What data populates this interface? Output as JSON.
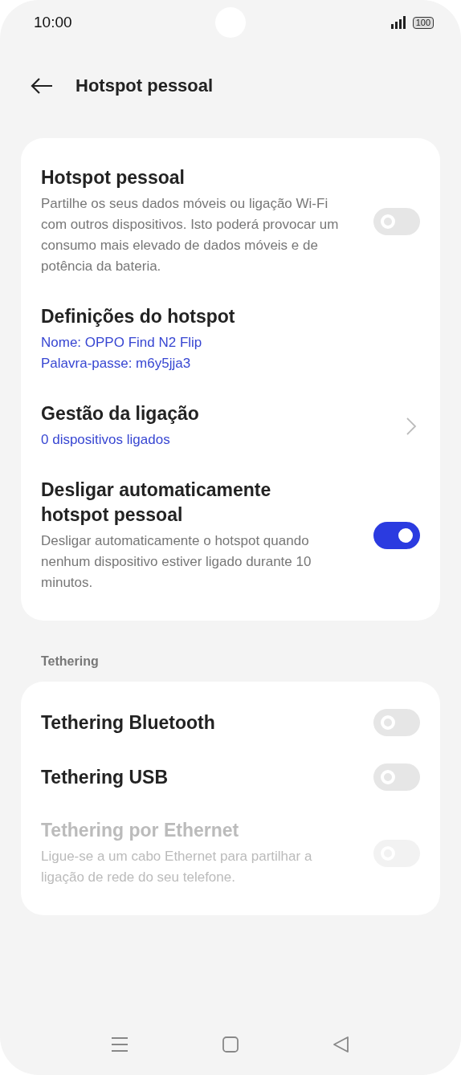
{
  "status_bar": {
    "time": "10:00",
    "battery": "100"
  },
  "header": {
    "title": "Hotspot pessoal"
  },
  "sections": [
    {
      "items": [
        {
          "kind": "toggle",
          "title": "Hotspot pessoal",
          "description": "Partilhe os seus dados móveis ou ligação Wi-Fi com outros dispositivos. Isto poderá provocar um consumo mais elevado de dados móveis e de potência da bateria.",
          "on": false,
          "disabled": false
        },
        {
          "kind": "info",
          "title": "Definições do hotspot",
          "details": [
            "Nome: OPPO Find N2 Flip",
            "Palavra-passe: m6y5jja3"
          ]
        },
        {
          "kind": "link",
          "title": "Gestão da ligação",
          "details": [
            "0 dispositivos ligados"
          ]
        },
        {
          "kind": "toggle",
          "title": "Desligar automaticamente hotspot pessoal",
          "description": "Desligar automaticamente o hotspot quando nenhum dispositivo estiver ligado durante 10 minutos.",
          "on": true,
          "disabled": false
        }
      ]
    },
    {
      "label": "Tethering",
      "items": [
        {
          "kind": "toggle",
          "title": "Tethering Bluetooth",
          "on": false,
          "disabled": false
        },
        {
          "kind": "toggle",
          "title": "Tethering USB",
          "on": false,
          "disabled": false
        },
        {
          "kind": "toggle",
          "title": "Tethering por Ethernet",
          "description": "Ligue-se a um cabo Ethernet para partilhar a ligação de rede do seu telefone.",
          "on": false,
          "disabled": true
        }
      ]
    }
  ]
}
